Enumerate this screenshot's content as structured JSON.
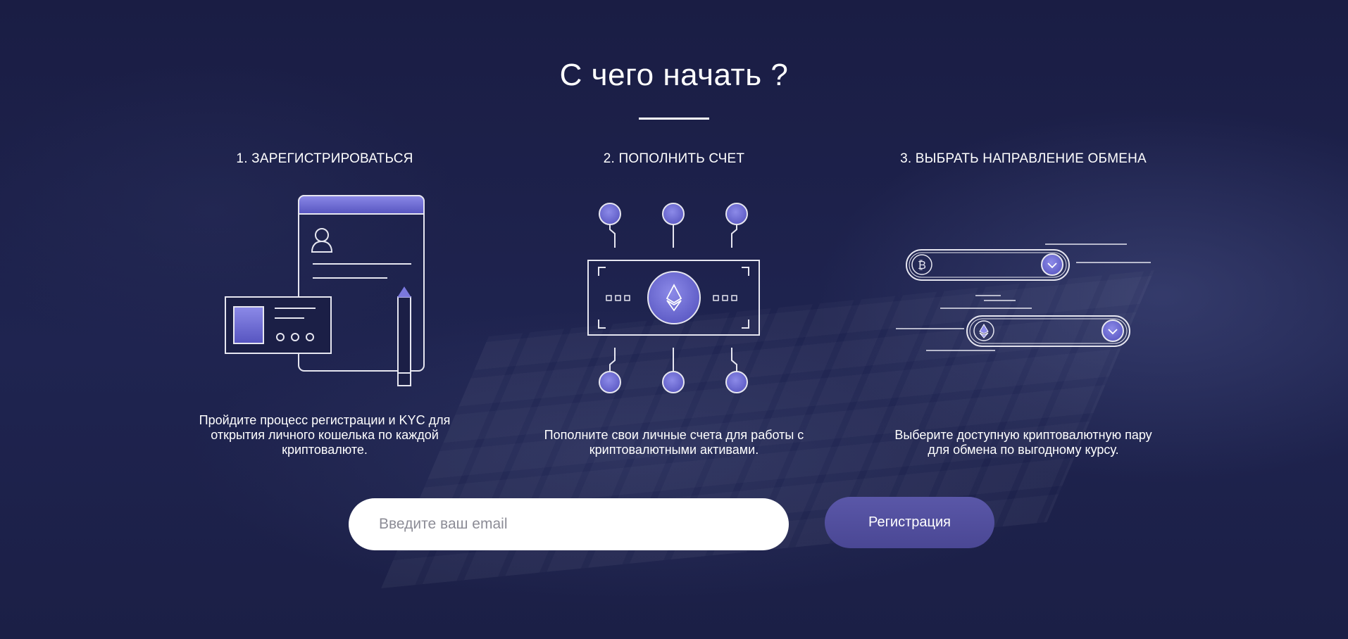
{
  "section": {
    "title": "С чего начать ?"
  },
  "steps": [
    {
      "heading": "1. ЗАРЕГИСТРИРОВАТЬСЯ",
      "description_lines": [
        "Пройдите процесс регистрации и KYC для",
        "открытия личного кошелька по каждой",
        "криптовалюте."
      ]
    },
    {
      "heading": "2. ПОПОЛНИТЬ СЧЕТ",
      "description_lines": [
        "Пополните свои личные счета для работы с",
        "криптовалютными активами."
      ]
    },
    {
      "heading": "3. ВЫБРАТЬ НАПРАВЛЕНИЕ ОБМЕНА",
      "description_lines": [
        "Выберите доступную криптовалютную пару",
        "для обмена по выгодному курсу."
      ]
    }
  ],
  "signup": {
    "email_placeholder": "Введите ваш email",
    "email_value": "",
    "button_label": "Регистрация"
  },
  "colors": {
    "background": "#1b1f46",
    "accent": "#6c6ad6",
    "button": "#5a57a8",
    "line": "#e6e6f0"
  },
  "icons": {
    "step1": "registration-document-icon",
    "step2": "ethereum-banknote-icon",
    "step3": "crypto-exchange-pair-icon"
  }
}
